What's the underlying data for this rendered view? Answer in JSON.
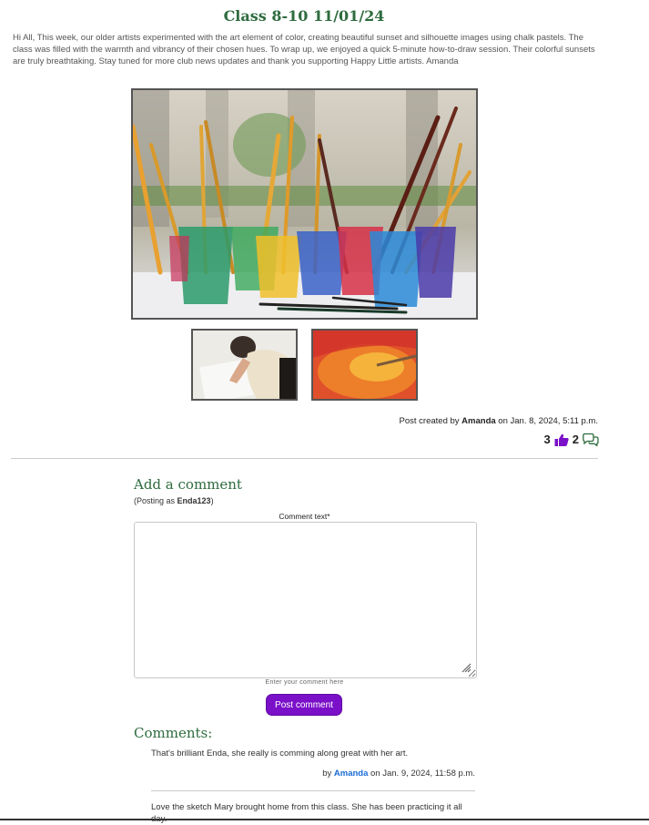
{
  "post": {
    "title": "Class 8-10 11/01/24",
    "intro": "Hi All, This week, our older artists experimented with the art element of color, creating beautiful sunset and silhouette images using chalk pastels. The class was filled with the warmth and vibrancy of their chosen hues. To wrap up, we enjoyed a quick 5-minute how-to-draw session. Their colorful sunsets are truly breathtaking. Stay tuned for more club news updates and thank you supporting Happy Little artists. Amanda",
    "meta_prefix": "Post created by",
    "author": "Amanda",
    "meta_on": "on",
    "created": "Jan. 8, 2024, 5:11 p.m.",
    "likes": "3",
    "like_icon": "thumbs-up-icon",
    "comment_count": "2",
    "comment_icon": "speech-bubbles-icon",
    "accent_color": "#7b10c9",
    "heading_color": "#2e6b3e"
  },
  "comment_form": {
    "heading": "Add a comment",
    "posting_prefix": "(Posting as ",
    "username": "Enda123",
    "posting_suffix": ")",
    "field_label": "Comment text*",
    "field_value": "",
    "help_text": "Enter your comment here",
    "submit_label": "Post comment"
  },
  "comments_section": {
    "heading": "Comments:",
    "items": [
      {
        "text": "That's brilliant Enda, she really is comming along great with her art.",
        "by": "by",
        "author": "Amanda",
        "on": "on",
        "date": "Jan. 9, 2024, 11:58 p.m."
      },
      {
        "text": "Love the sketch Mary brought home from this class. She has been practicing it all day."
      }
    ]
  }
}
